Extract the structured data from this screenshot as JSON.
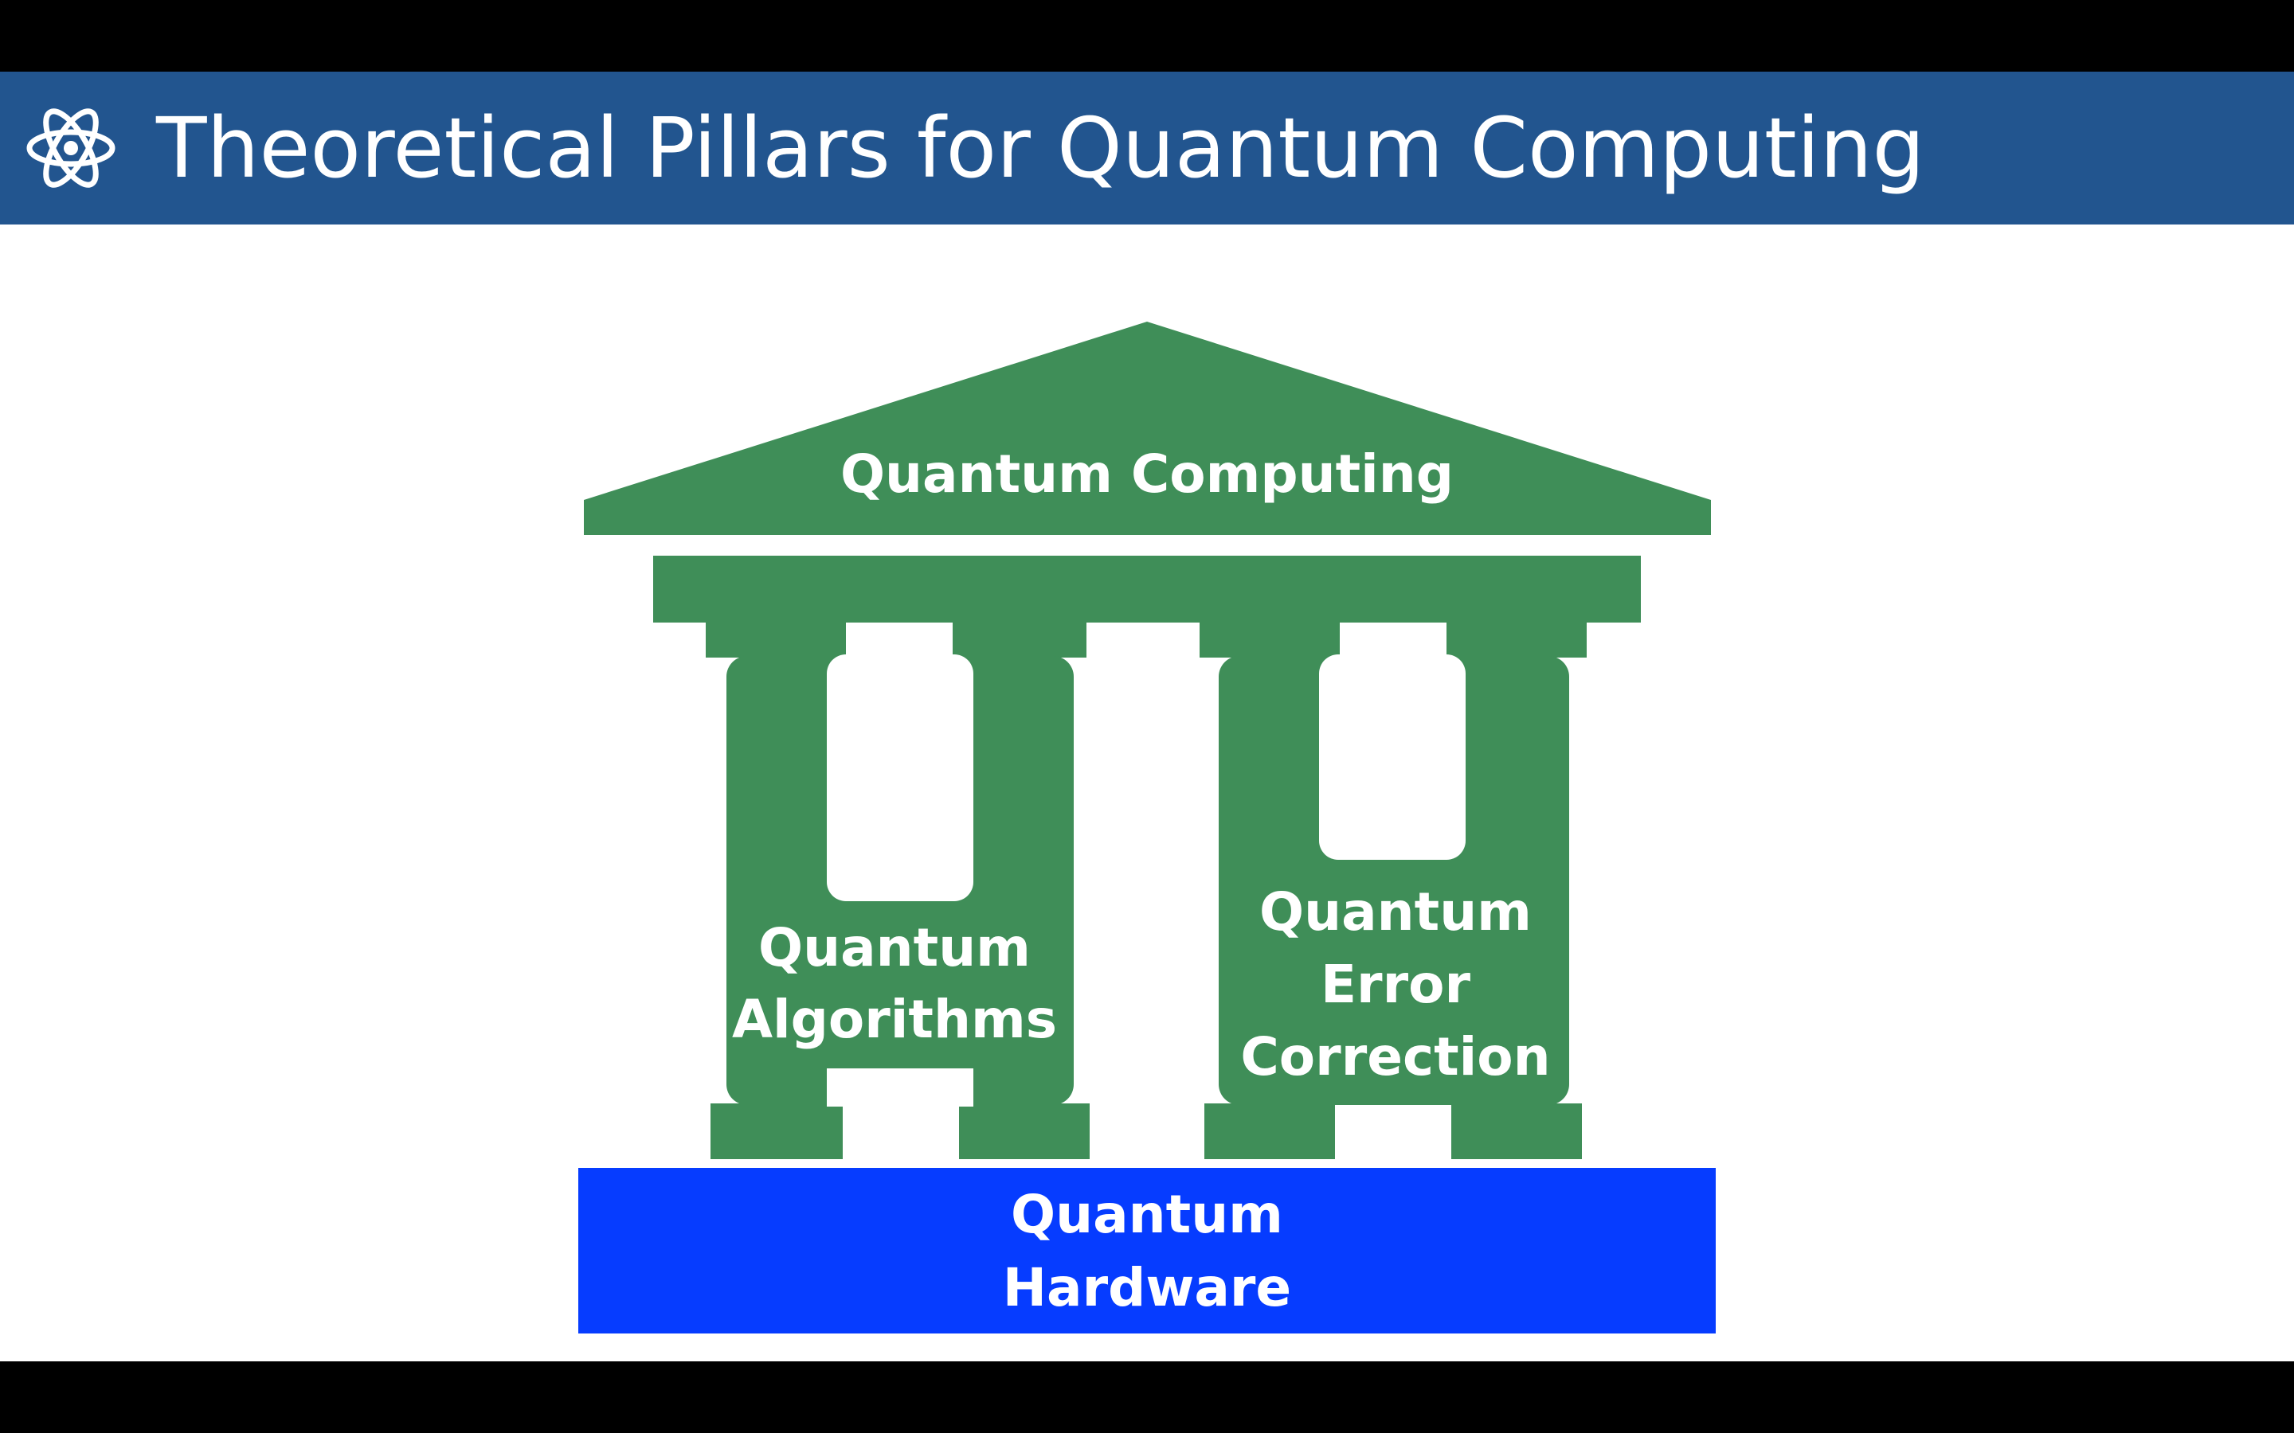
{
  "header": {
    "title": "Theoretical Pillars for Quantum Computing",
    "icon": "atom-icon"
  },
  "diagram": {
    "roof_label": "Quantum Computing",
    "pillar_left_label": [
      "Quantum",
      "Algorithms"
    ],
    "pillar_right_label": [
      "Quantum",
      "Error",
      "Correction"
    ],
    "foundation_label": [
      "Quantum",
      "Hardware"
    ]
  },
  "colors": {
    "title_bar": "#22558f",
    "temple_green": "#3f8e58",
    "foundation_blue": "#063cff",
    "text": "#ffffff"
  }
}
